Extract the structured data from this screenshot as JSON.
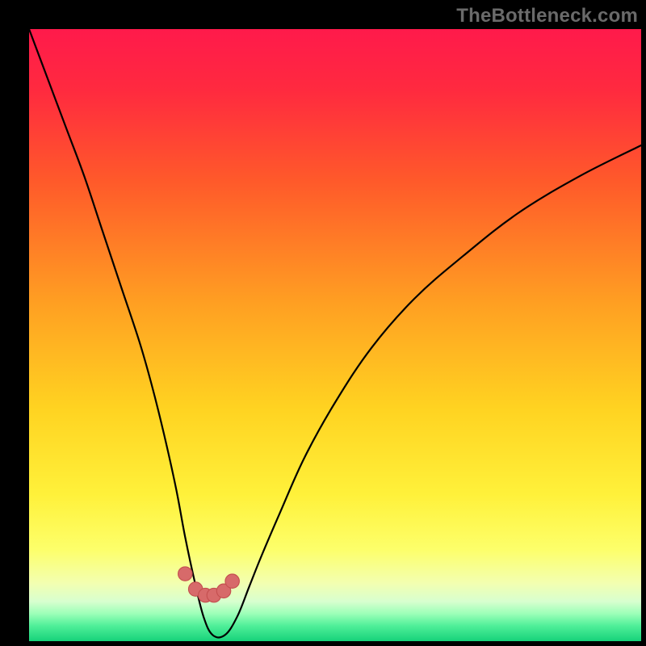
{
  "watermark": {
    "text": "TheBottleneck.com"
  },
  "colors": {
    "black": "#000000",
    "curve": "#000000",
    "marker_fill": "#d76a6a",
    "marker_stroke": "#c44f4f",
    "gradient_stops": [
      {
        "offset": 0.0,
        "color": "#ff1a4b"
      },
      {
        "offset": 0.1,
        "color": "#ff2a3f"
      },
      {
        "offset": 0.25,
        "color": "#ff5a2a"
      },
      {
        "offset": 0.45,
        "color": "#ffa022"
      },
      {
        "offset": 0.62,
        "color": "#ffd321"
      },
      {
        "offset": 0.76,
        "color": "#fff13a"
      },
      {
        "offset": 0.85,
        "color": "#fdff6a"
      },
      {
        "offset": 0.905,
        "color": "#f3ffb0"
      },
      {
        "offset": 0.935,
        "color": "#d8ffcf"
      },
      {
        "offset": 0.955,
        "color": "#9cffb8"
      },
      {
        "offset": 0.975,
        "color": "#4fef99"
      },
      {
        "offset": 1.0,
        "color": "#16d27a"
      }
    ]
  },
  "chart_data": {
    "type": "line",
    "title": "",
    "xlabel": "",
    "ylabel": "",
    "xlim": [
      0,
      100
    ],
    "ylim": [
      0,
      100
    ],
    "grid": false,
    "note": "x in percent of horizontal span; y is bottleneck percent (0 = bottom/green, 100 = top/red). V-shaped curve.",
    "series": [
      {
        "name": "bottleneck-curve",
        "x": [
          0,
          3,
          6,
          9,
          12,
          15,
          18,
          20,
          22,
          24,
          25.5,
          27,
          28.5,
          30,
          32,
          34,
          36,
          38,
          41,
          45,
          50,
          56,
          63,
          71,
          80,
          90,
          100
        ],
        "y": [
          100,
          92,
          84,
          76,
          67,
          58,
          49,
          42,
          34,
          25,
          17,
          10,
          4,
          1,
          1,
          4,
          9,
          14,
          21,
          30,
          39,
          48,
          56,
          63,
          70,
          76,
          81
        ]
      }
    ],
    "markers": {
      "name": "highlighted-points",
      "x": [
        25.5,
        27.2,
        28.8,
        30.2,
        31.8,
        33.2
      ],
      "y": [
        11.0,
        8.5,
        7.5,
        7.5,
        8.2,
        9.8
      ]
    }
  }
}
